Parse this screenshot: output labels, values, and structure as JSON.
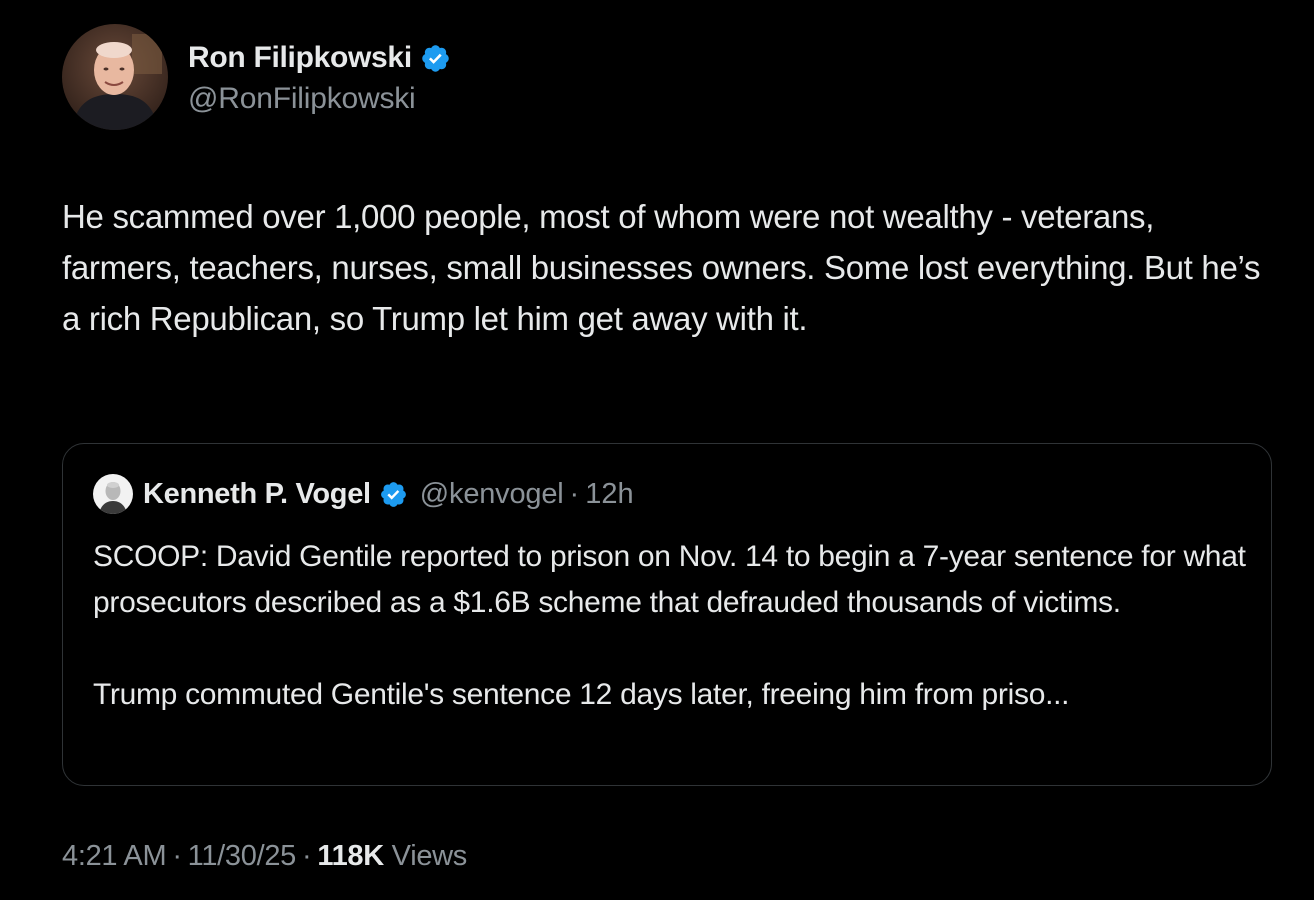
{
  "tweet": {
    "author": {
      "name": "Ron Filipkowski",
      "handle": "@RonFilipkowski",
      "verified_color": "#1d9bf0"
    },
    "text": "He scammed over 1,000 people, most of whom were not wealthy - veterans, farmers, teachers, nurses, small businesses owners. Some lost everything. But he’s a rich Republican, so Trump let him get away with it.",
    "quoted": {
      "name": "Kenneth P. Vogel",
      "handle": "@kenvogel",
      "separator": "·",
      "time": "12h",
      "paragraphs": [
        "SCOOP: David Gentile reported to prison on Nov. 14 to begin a 7-year sentence for what prosecutors described as a $1.6B scheme that defrauded thousands of victims.",
        "Trump commuted Gentile's sentence 12 days later, freeing him from priso..."
      ]
    },
    "meta": {
      "time": "4:21 AM",
      "separator": "·",
      "date": "11/30/25",
      "views_count": "118K",
      "views_label": "Views"
    }
  },
  "icons": {
    "verified": "verified-badge-icon"
  },
  "colors": {
    "background": "#000000",
    "text": "#e7e9ea",
    "secondary_text": "#8b9298",
    "border": "#2f3336",
    "verified": "#1d9bf0"
  }
}
